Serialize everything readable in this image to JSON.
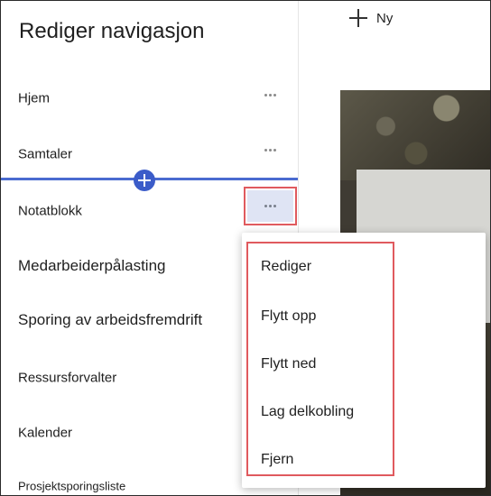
{
  "header": {
    "new_label": "Ny"
  },
  "panel": {
    "title": "Rediger navigasjon",
    "items": [
      {
        "label": "Hjem"
      },
      {
        "label": "Samtaler"
      },
      {
        "label": "Notatblokk"
      },
      {
        "label": "Medarbeiderpålasting"
      },
      {
        "label": "Sporing av arbeidsfremdrift"
      },
      {
        "label": "Ressursforvalter"
      },
      {
        "label": "Kalender"
      },
      {
        "label": "Prosjektsporingsliste"
      }
    ]
  },
  "context_menu": {
    "items": [
      {
        "label": "Rediger"
      },
      {
        "label": "Flytt opp"
      },
      {
        "label": "Flytt ned"
      },
      {
        "label": "Lag delkobling"
      },
      {
        "label": "Fjern"
      }
    ]
  },
  "colors": {
    "accent": "#3b5cc9",
    "highlight_border": "#e05a5e",
    "active_dots_bg": "#dfe4f4"
  },
  "icons": {
    "new": "plus-icon",
    "more": "more-horizontal-icon",
    "insert": "add-circle-icon"
  }
}
